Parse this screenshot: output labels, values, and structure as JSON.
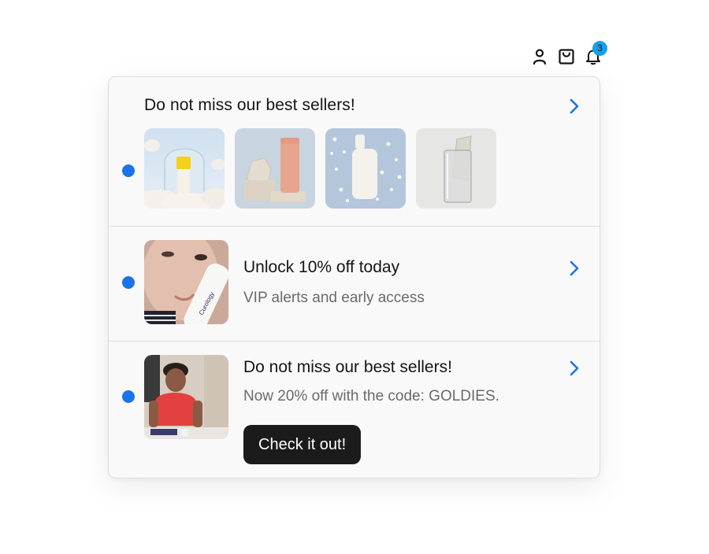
{
  "header": {
    "notification_count": "3",
    "icons": [
      "user-icon",
      "shopping-bag-icon",
      "bell-icon"
    ]
  },
  "notifications": [
    {
      "title": "Do not miss our best sellers!",
      "products": [
        "yellow-cap-dropper-bottle",
        "peach-tube-on-stone",
        "white-serum-bottle",
        "tube-in-glass"
      ]
    },
    {
      "title": "Unlock 10% off today",
      "subtitle": "VIP alerts and early access",
      "image_text": "Curology"
    },
    {
      "title": "Do not miss our best sellers!",
      "subtitle": "Now 20% off with the code: GOLDIES.",
      "cta_label": "Check it out!"
    }
  ],
  "colors": {
    "unread_dot": "#1a73e8",
    "chevron": "#1a73e8",
    "badge": "#1a9fe8",
    "cta_bg": "#1b1b1b"
  }
}
